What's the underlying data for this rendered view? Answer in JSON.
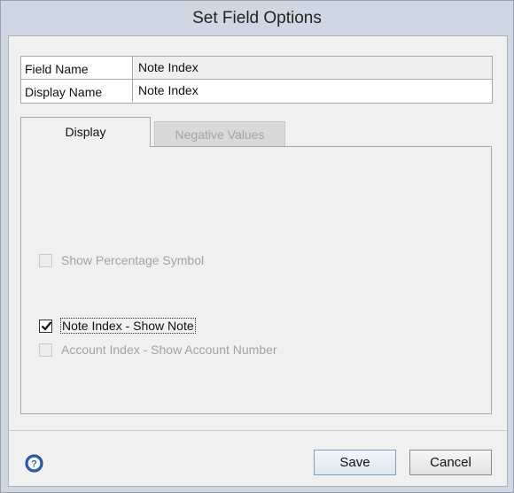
{
  "window": {
    "title": "Set Field Options"
  },
  "fields": {
    "field_name_label": "Field Name",
    "field_name_value": "Note Index",
    "display_name_label": "Display Name",
    "display_name_value": "Note Index"
  },
  "tabs": [
    {
      "label": "Display",
      "active": true
    },
    {
      "label": "Negative Values",
      "active": false,
      "disabled": true
    }
  ],
  "options": {
    "show_percentage": {
      "label": "Show Percentage Symbol",
      "checked": false,
      "enabled": false
    },
    "note_index_show_note": {
      "label": "Note Index - Show Note",
      "checked": true,
      "enabled": true
    },
    "account_index_show_number": {
      "label": "Account Index - Show Account Number",
      "checked": false,
      "enabled": false
    }
  },
  "buttons": {
    "save": "Save",
    "cancel": "Cancel"
  },
  "icons": {
    "help": "help-icon"
  },
  "colors": {
    "help_blue": "#2f62b8",
    "titlebar": "#cfd8e2"
  }
}
